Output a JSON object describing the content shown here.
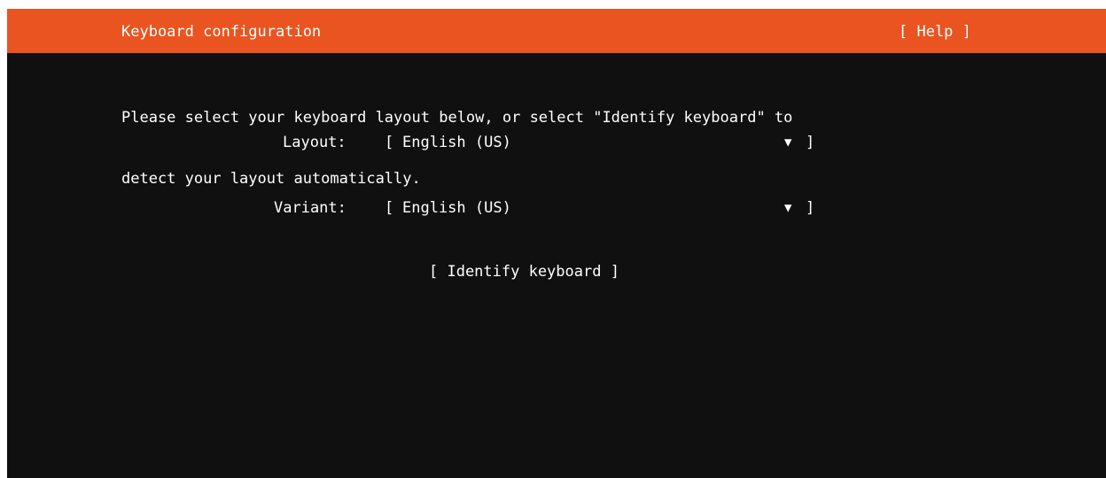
{
  "header": {
    "title": "Keyboard configuration",
    "help": "[ Help ]"
  },
  "intro": {
    "line1": "Please select your keyboard layout below, or select \"Identify keyboard\" to",
    "line2": "detect your layout automatically."
  },
  "layout_field": {
    "label": "Layout:",
    "bracket_open": "[",
    "value": "English (US)",
    "arrow": "▼",
    "bracket_close": "]"
  },
  "variant_field": {
    "label": "Variant:",
    "bracket_open": "[",
    "value": "English (US)",
    "arrow": "▼",
    "bracket_close": "]"
  },
  "identify_button": {
    "label": "[ Identify keyboard ]"
  },
  "colors": {
    "header_bg": "#e95420",
    "terminal_bg": "#101010",
    "text": "#ffffff"
  }
}
